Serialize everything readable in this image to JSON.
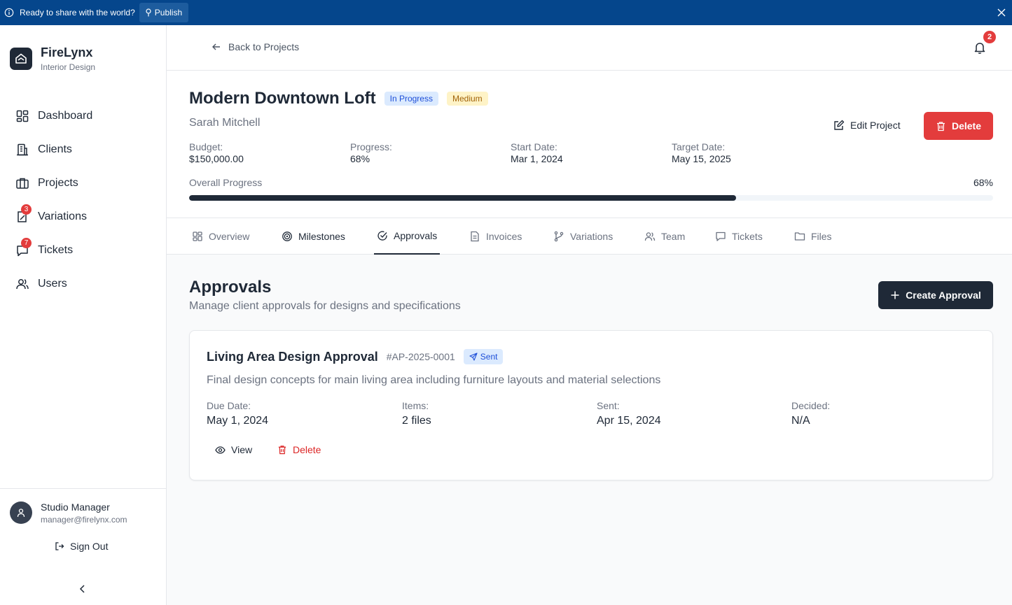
{
  "banner": {
    "text": "Ready to share with the world?",
    "publish_label": "Publish"
  },
  "brand": {
    "name": "FireLynx",
    "subtitle": "Interior Design"
  },
  "sidebar": {
    "items": [
      {
        "label": "Dashboard",
        "icon": "dashboard-icon"
      },
      {
        "label": "Clients",
        "icon": "building-icon"
      },
      {
        "label": "Projects",
        "icon": "briefcase-icon"
      },
      {
        "label": "Variations",
        "icon": "edit-doc-icon",
        "badge": "3"
      },
      {
        "label": "Tickets",
        "icon": "message-icon",
        "badge": "7"
      },
      {
        "label": "Users",
        "icon": "users-icon"
      }
    ]
  },
  "user": {
    "name": "Studio Manager",
    "email": "manager@firelynx.com",
    "sign_out": "Sign Out"
  },
  "topbar": {
    "back_label": "Back to Projects",
    "notification_count": "2"
  },
  "project": {
    "title": "Modern Downtown Loft",
    "status": "In Progress",
    "priority": "Medium",
    "client": "Sarah Mitchell",
    "budget_label": "Budget:",
    "budget": "$150,000.00",
    "progress_label": "Progress:",
    "progress": "68%",
    "start_label": "Start Date:",
    "start": "Mar 1, 2024",
    "target_label": "Target Date:",
    "target": "May 15, 2025",
    "overall_label": "Overall Progress",
    "overall_value": "68%",
    "overall_fraction": 0.68,
    "edit_label": "Edit Project",
    "delete_label": "Delete"
  },
  "tabs": [
    {
      "label": "Overview",
      "icon": "grid-icon"
    },
    {
      "label": "Milestones",
      "icon": "target-icon"
    },
    {
      "label": "Approvals",
      "icon": "check-circle-icon"
    },
    {
      "label": "Invoices",
      "icon": "file-icon"
    },
    {
      "label": "Variations",
      "icon": "branch-icon"
    },
    {
      "label": "Team",
      "icon": "team-icon"
    },
    {
      "label": "Tickets",
      "icon": "chat-icon"
    },
    {
      "label": "Files",
      "icon": "folder-icon"
    }
  ],
  "approvals": {
    "title": "Approvals",
    "subtitle": "Manage client approvals for designs and specifications",
    "create_label": "Create Approval",
    "card": {
      "title": "Living Area Design Approval",
      "id": "#AP-2025-0001",
      "status": "Sent",
      "description": "Final design concepts for main living area including furniture layouts and material selections",
      "due_label": "Due Date:",
      "due": "May 1, 2024",
      "items_label": "Items:",
      "items": "2 files",
      "sent_label": "Sent:",
      "sent": "Apr 15, 2024",
      "decided_label": "Decided:",
      "decided": "N/A",
      "view_label": "View",
      "delete_label": "Delete"
    }
  },
  "colors": {
    "banner": "#05468c",
    "primary": "#1f2937",
    "danger": "#e33c3c",
    "badge_blue": "#dbeafe",
    "badge_yellow": "#fef3c7"
  }
}
